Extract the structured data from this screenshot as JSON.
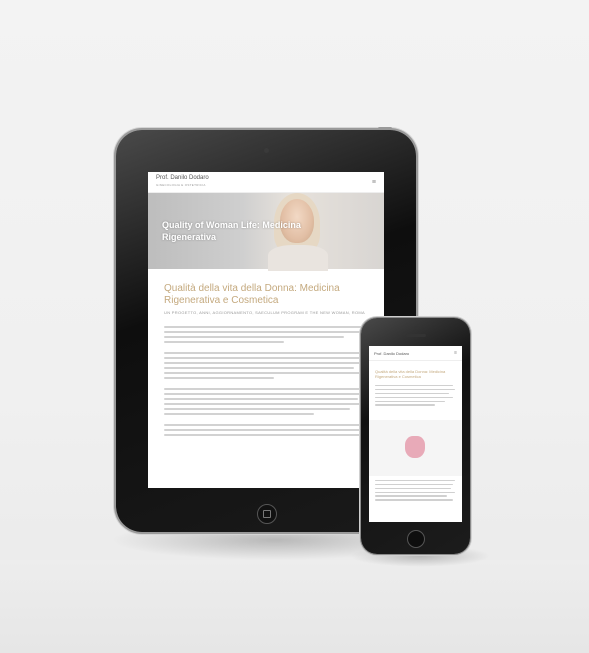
{
  "tablet": {
    "site_name": "Prof. Danilo Dodaro",
    "site_tagline": "GINECOLOGIA E OSTETRICIA",
    "menu_icon": "hamburger-icon",
    "hero_title": "Quality of Woman Life: Medicina Rigenerativa",
    "article_title": "Qualità della vita della Donna: Medicina Rigenerativa e Cosmetica",
    "article_meta": "UN PROGETTO, ANNI, AGGIORNAMENTO, SAECULUM PROGRAM E THE NEW WOMAN, ROMA"
  },
  "phone": {
    "site_name": "Prof. Danilo Dodaro",
    "menu_icon": "hamburger-icon",
    "article_title": "Qualità della vita della Donna: Medicina Rigenerativa e Cosmetica",
    "image_icon": "uterus-icon"
  },
  "colors": {
    "accent": "#c4a97e",
    "device_body": "#111111",
    "icon_pink": "#e8aab8"
  }
}
